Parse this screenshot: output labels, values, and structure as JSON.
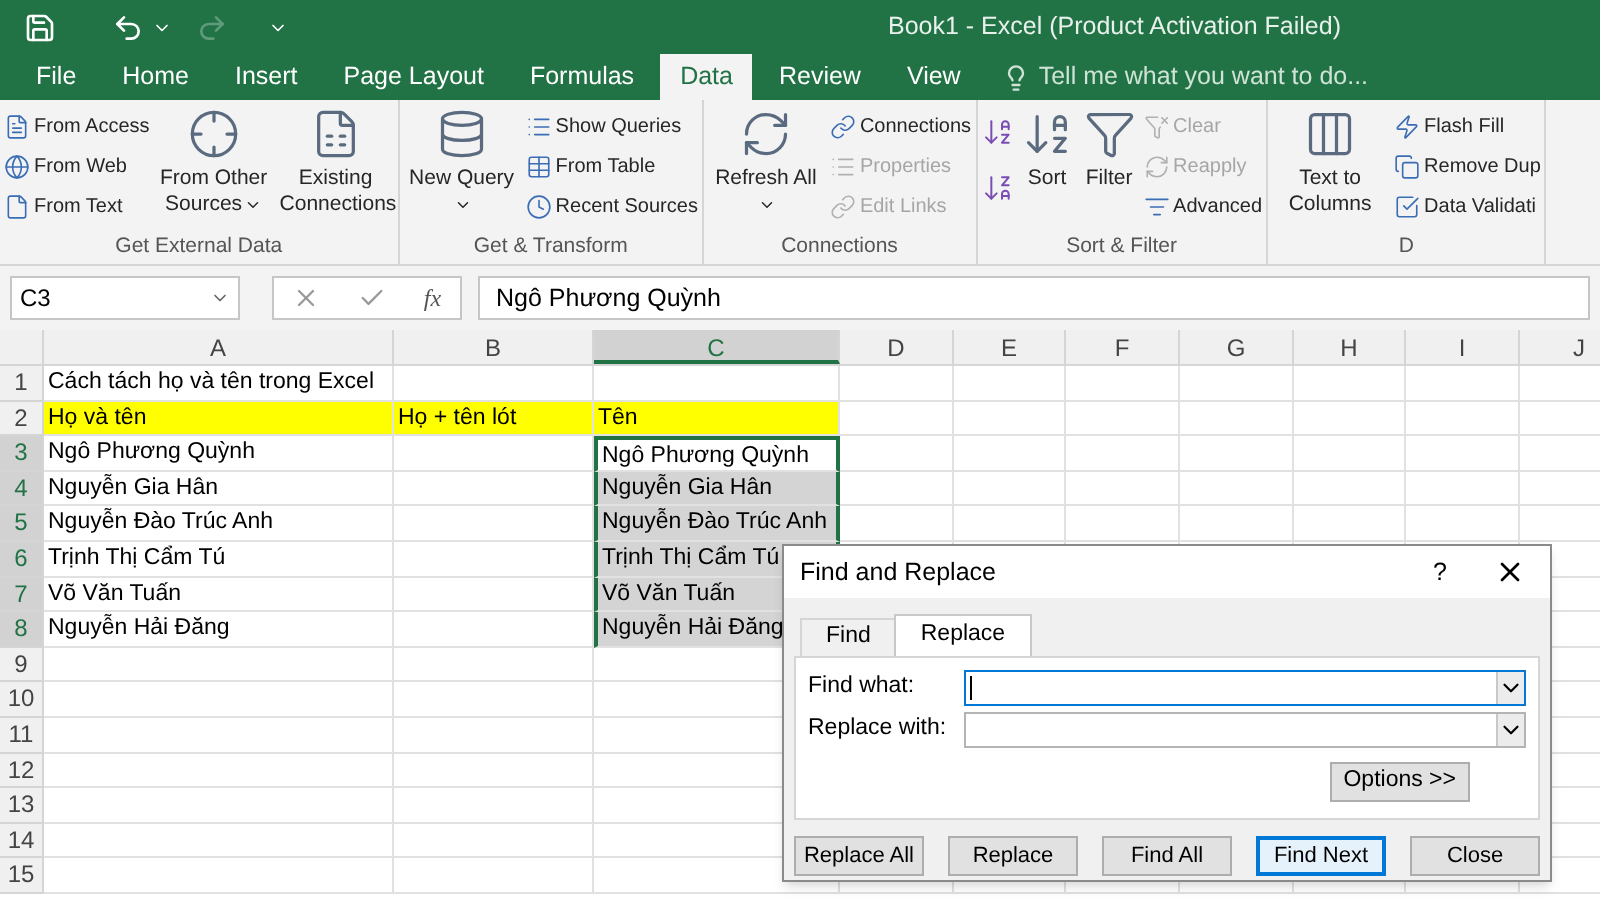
{
  "title_bar": {
    "title": "Book1 - Excel (Product Activation Failed)"
  },
  "ribbon_tabs": [
    {
      "label": "File",
      "selected": false
    },
    {
      "label": "Home",
      "selected": false
    },
    {
      "label": "Insert",
      "selected": false
    },
    {
      "label": "Page Layout",
      "selected": false
    },
    {
      "label": "Formulas",
      "selected": false
    },
    {
      "label": "Data",
      "selected": true
    },
    {
      "label": "Review",
      "selected": false
    },
    {
      "label": "View",
      "selected": false
    }
  ],
  "tell_me": {
    "placeholder": "Tell me what you want to do..."
  },
  "ribbon_groups": [
    {
      "label": "Get External Data",
      "items": [
        {
          "kind": "stack",
          "items": [
            {
              "label": "From Access",
              "disabled": false
            },
            {
              "label": "From Web",
              "disabled": false
            },
            {
              "label": "From Text",
              "disabled": false
            }
          ]
        },
        {
          "kind": "large",
          "label": "From Other Sources",
          "dropdown": true
        },
        {
          "kind": "large",
          "label": "Existing Connections",
          "dropdown": false
        }
      ]
    },
    {
      "label": "Get & Transform",
      "items": [
        {
          "kind": "large",
          "label": "New Query",
          "dropdown": true
        },
        {
          "kind": "stack",
          "items": [
            {
              "label": "Show Queries",
              "disabled": false
            },
            {
              "label": "From Table",
              "disabled": false
            },
            {
              "label": "Recent Sources",
              "disabled": false
            }
          ]
        }
      ]
    },
    {
      "label": "Connections",
      "items": [
        {
          "kind": "large",
          "label": "Refresh All",
          "dropdown": true
        },
        {
          "kind": "stack",
          "items": [
            {
              "label": "Connections",
              "disabled": false
            },
            {
              "label": "Properties",
              "disabled": true
            },
            {
              "label": "Edit Links",
              "disabled": true
            }
          ]
        }
      ]
    },
    {
      "label": "Sort & Filter",
      "items": [
        {
          "kind": "sort_buttons"
        },
        {
          "kind": "large",
          "label": "Sort",
          "dropdown": false
        },
        {
          "kind": "large",
          "label": "Filter",
          "dropdown": false
        },
        {
          "kind": "stack",
          "items": [
            {
              "label": "Clear",
              "disabled": true
            },
            {
              "label": "Reapply",
              "disabled": true
            },
            {
              "label": "Advanced",
              "disabled": false
            }
          ]
        }
      ]
    },
    {
      "label": "D",
      "items": [
        {
          "kind": "large",
          "label": "Text to Columns",
          "dropdown": false
        },
        {
          "kind": "stack",
          "items": [
            {
              "label": "Flash Fill",
              "disabled": false
            },
            {
              "label": "Remove Dup",
              "disabled": false
            },
            {
              "label": "Data Validati",
              "disabled": false
            }
          ]
        }
      ]
    }
  ],
  "formula_bar": {
    "name_box": "C3",
    "function_label": "fx",
    "value": "Ngô Phương Quỳnh"
  },
  "sheet": {
    "columns": [
      {
        "label": "A",
        "selected": false
      },
      {
        "label": "B",
        "selected": false
      },
      {
        "label": "C",
        "selected": true
      },
      {
        "label": "D",
        "selected": false
      },
      {
        "label": "E",
        "selected": false
      },
      {
        "label": "F",
        "selected": false
      },
      {
        "label": "G",
        "selected": false
      },
      {
        "label": "H",
        "selected": false
      },
      {
        "label": "I",
        "selected": false
      },
      {
        "label": "J",
        "selected": false
      }
    ],
    "rows": [
      {
        "label": "1",
        "selected": false,
        "highlighted": false,
        "cells": [
          {
            "text": "Cách tách họ và tên trong Excel",
            "selected": false,
            "active": false
          }
        ]
      },
      {
        "label": "2",
        "selected": false,
        "highlighted": true,
        "cells": [
          {
            "text": "Họ và tên",
            "selected": false,
            "active": false
          },
          {
            "text": "Họ + tên lót",
            "selected": false,
            "active": false
          },
          {
            "text": "Tên",
            "selected": false,
            "active": false
          }
        ]
      },
      {
        "label": "3",
        "selected": true,
        "highlighted": false,
        "cells": [
          {
            "text": "Ngô Phương Quỳnh",
            "selected": false,
            "active": false
          },
          {
            "text": "",
            "selected": false,
            "active": false
          },
          {
            "text": "Ngô Phương Quỳnh",
            "selected": false,
            "active": true
          }
        ]
      },
      {
        "label": "4",
        "selected": true,
        "highlighted": false,
        "cells": [
          {
            "text": "Nguyễn Gia Hân",
            "selected": false,
            "active": false
          },
          {
            "text": "",
            "selected": false,
            "active": false
          },
          {
            "text": "Nguyễn Gia Hân",
            "selected": true,
            "active": false
          }
        ]
      },
      {
        "label": "5",
        "selected": true,
        "highlighted": false,
        "cells": [
          {
            "text": "Nguyễn Đào Trúc Anh",
            "selected": false,
            "active": false
          },
          {
            "text": "",
            "selected": false,
            "active": false
          },
          {
            "text": "Nguyễn Đào Trúc Anh",
            "selected": true,
            "active": false
          }
        ]
      },
      {
        "label": "6",
        "selected": true,
        "highlighted": false,
        "cells": [
          {
            "text": "Trịnh Thị Cẩm Tú",
            "selected": false,
            "active": false
          },
          {
            "text": "",
            "selected": false,
            "active": false
          },
          {
            "text": "Trịnh Thị Cẩm Tú",
            "selected": true,
            "active": false
          }
        ]
      },
      {
        "label": "7",
        "selected": true,
        "highlighted": false,
        "cells": [
          {
            "text": "Võ Văn Tuấn",
            "selected": false,
            "active": false
          },
          {
            "text": "",
            "selected": false,
            "active": false
          },
          {
            "text": "Võ Văn Tuấn",
            "selected": true,
            "active": false
          }
        ]
      },
      {
        "label": "8",
        "selected": true,
        "highlighted": false,
        "cells": [
          {
            "text": "Nguyễn Hải Đăng",
            "selected": false,
            "active": false
          },
          {
            "text": "",
            "selected": false,
            "active": false
          },
          {
            "text": "Nguyễn Hải Đăng",
            "selected": true,
            "active": false
          }
        ]
      },
      {
        "label": "9",
        "selected": false,
        "highlighted": false
      },
      {
        "label": "10",
        "selected": false,
        "highlighted": false
      },
      {
        "label": "11",
        "selected": false,
        "highlighted": false
      },
      {
        "label": "12",
        "selected": false,
        "highlighted": false
      },
      {
        "label": "13",
        "selected": false,
        "highlighted": false
      },
      {
        "label": "14",
        "selected": false,
        "highlighted": false
      },
      {
        "label": "15",
        "selected": false,
        "highlighted": false
      }
    ]
  },
  "dialog": {
    "title": "Find and Replace",
    "help": "?",
    "tabs": [
      {
        "label": "Find",
        "selected": false
      },
      {
        "label": "Replace",
        "selected": true
      }
    ],
    "fields": [
      {
        "label": "Find what:",
        "focused": true
      },
      {
        "label": "Replace with:",
        "focused": false
      }
    ],
    "options_button": "Options >>",
    "buttons": [
      {
        "label": "Replace All",
        "default": false
      },
      {
        "label": "Replace",
        "default": false
      },
      {
        "label": "Find All",
        "default": false
      },
      {
        "label": "Find Next",
        "default": true
      },
      {
        "label": "Close",
        "default": false
      }
    ]
  }
}
